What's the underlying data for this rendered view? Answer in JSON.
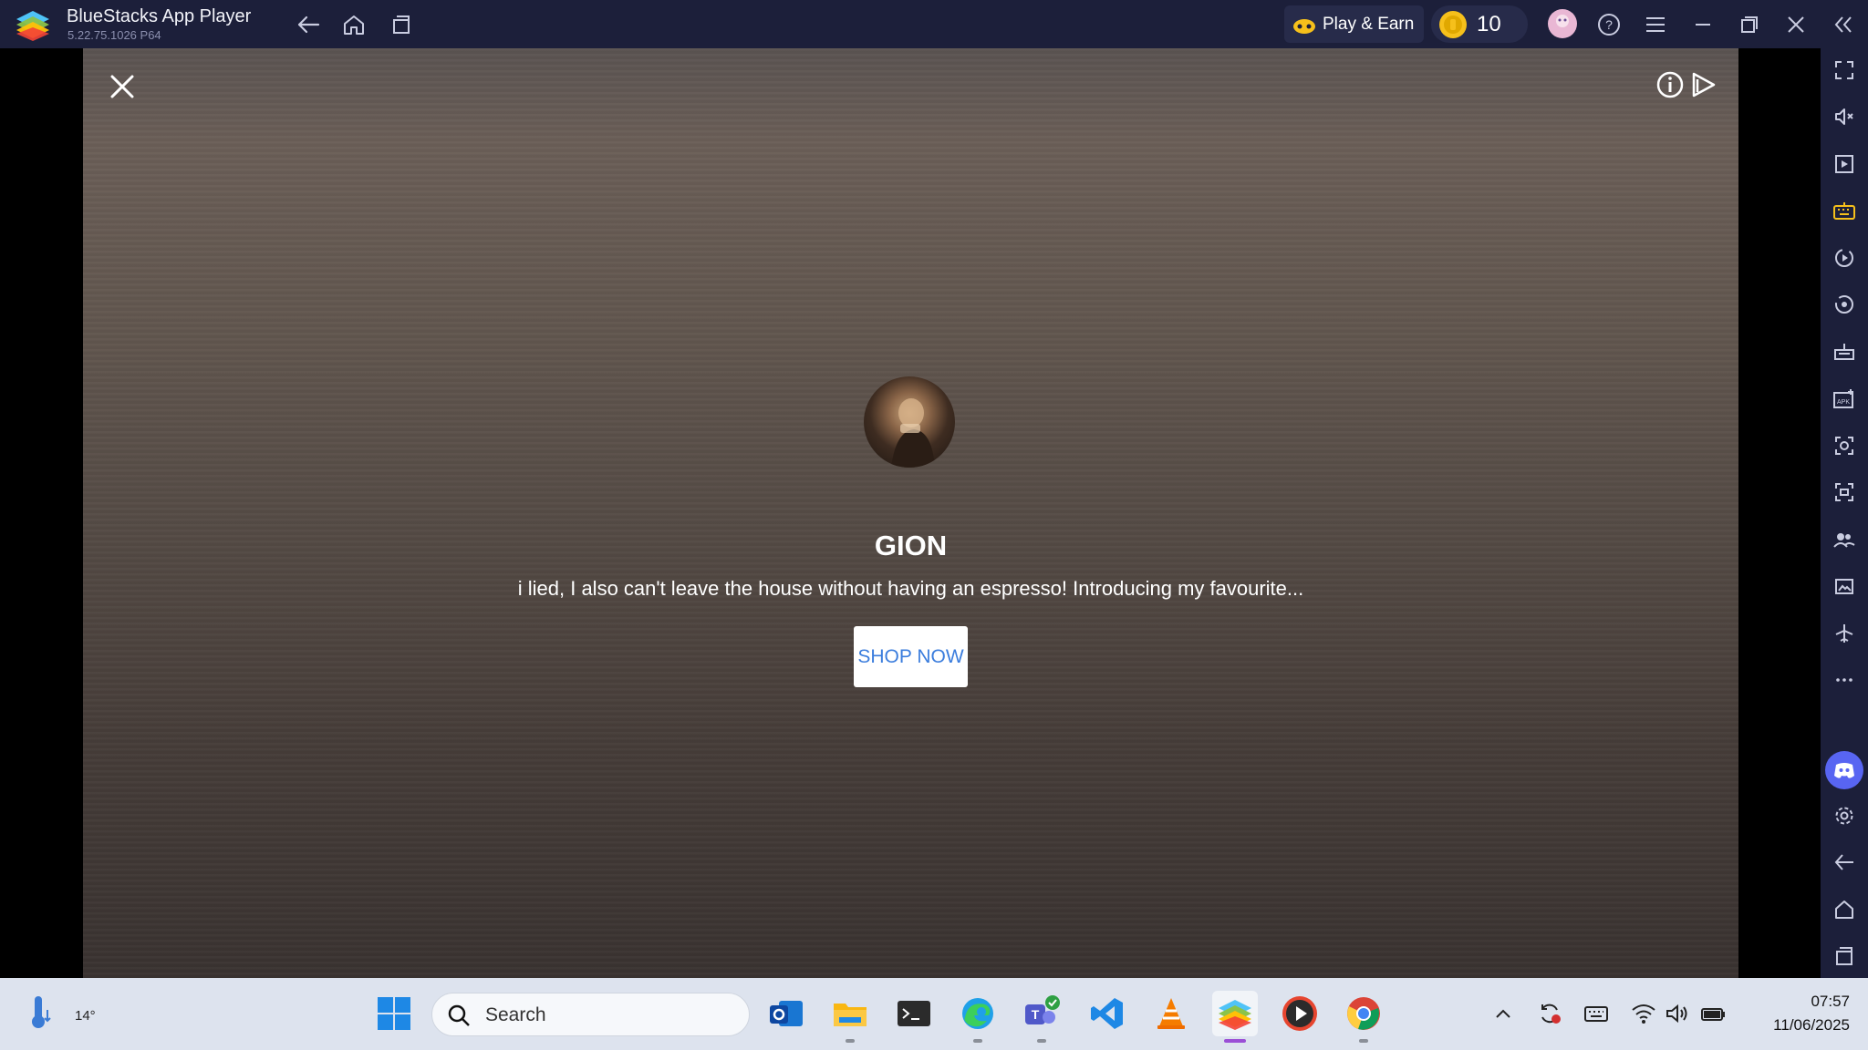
{
  "window": {
    "title": "BlueStacks App Player",
    "version": "5.22.75.1026  P64",
    "play_earn_label": "Play & Earn",
    "coins": "10"
  },
  "ad": {
    "brand": "GION",
    "tagline": "i lied, I also can't leave the house without having an espresso! Introducing my favourite...",
    "cta": "SHOP NOW"
  },
  "sidebar": {
    "icons": [
      "fullscreen-icon",
      "volume-mute-icon",
      "media-icon",
      "keyboard-icon",
      "macro-icon",
      "sync-icon",
      "eco-mode-icon",
      "apk-icon",
      "screenshot-icon",
      "record-icon",
      "multi-instance-icon",
      "media-folder-icon",
      "airplane-icon",
      "more-icon",
      "discord-icon",
      "settings-icon",
      "back-icon",
      "home-icon",
      "recents-icon"
    ]
  },
  "taskbar": {
    "weather_temp": "14°",
    "search_placeholder": "Search",
    "clock_time": "07:57",
    "clock_date": "11/06/2025"
  },
  "colors": {
    "titlebar": "#1c1f3a",
    "accent_blue": "#3b7ddd",
    "discord": "#5865f2",
    "coin": "#f6c01b"
  }
}
